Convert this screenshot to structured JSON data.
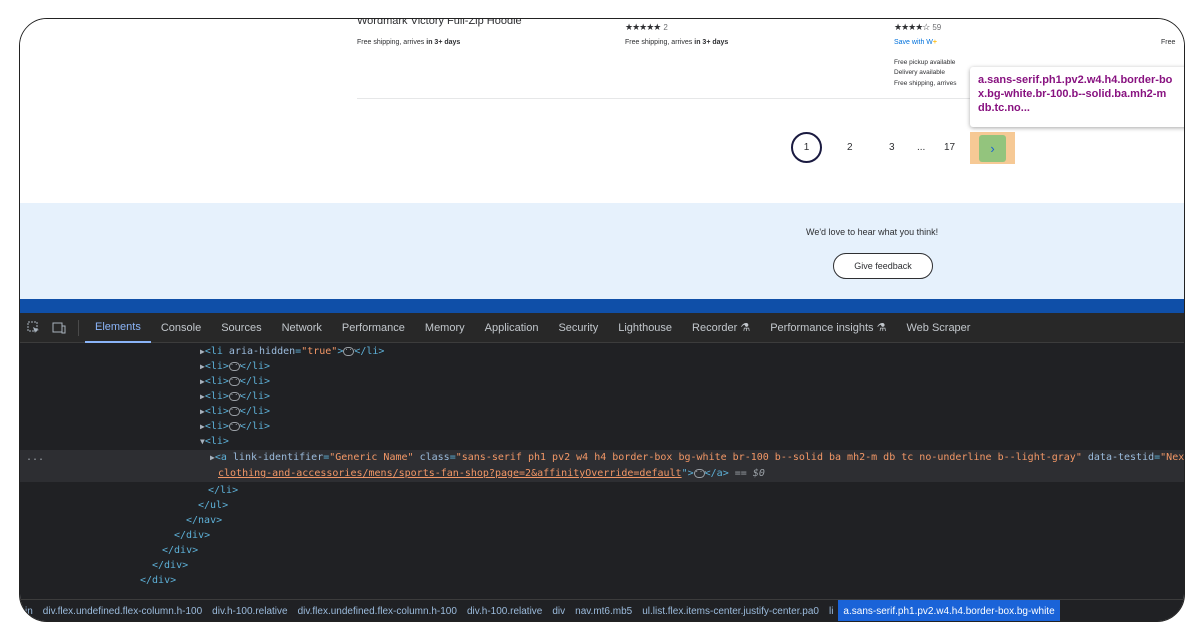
{
  "page": {
    "product_title": "Wordmark Victory Full-Zip Hoodie",
    "col1": {
      "shipping_prefix": "Free shipping, arrives ",
      "shipping_bold": "in 3+ days"
    },
    "col2": {
      "stars": "★★★★★",
      "count": "2",
      "shipping_prefix": "Free shipping, arrives ",
      "shipping_bold": "in 3+ days"
    },
    "col3": {
      "stars": "★★★★☆",
      "count": "59",
      "save_text": "Save with W+",
      "save_prefix": "Save with W",
      "save_plus": "+",
      "pickup": "Free pickup available",
      "delivery": "Delivery available",
      "shipping": "Free shipping, arrives"
    },
    "col4": {
      "shipping": "Free"
    },
    "tooltip": "a.sans-serif.ph1.pv2.w4.h4.border-box.bg-white.br-100.b--solid.ba.mh2-m db.tc.no...",
    "tooltip_lines": [
      "a.sans-serif.ph1.pv2.w4.h4.border-bo",
      "x.bg-white.br-100.b--solid.ba.mh2-m",
      "db.tc.no..."
    ],
    "pagination": {
      "current": "1",
      "p2": "2",
      "p3": "3",
      "ellipsis": "...",
      "last": "17",
      "next": "›"
    },
    "feedback": {
      "text": "We'd love to hear what you think!",
      "button": "Give feedback"
    }
  },
  "devtools": {
    "tabs": [
      "Elements",
      "Console",
      "Sources",
      "Network",
      "Performance",
      "Memory",
      "Application",
      "Security",
      "Lighthouse",
      "Recorder ⚗",
      "Performance insights ⚗",
      "Web Scraper"
    ],
    "active_tab": "Elements",
    "tree": {
      "li_hidden_tag": "<li",
      "li_hidden_attr": "aria-hidden",
      "li_hidden_val": "\"true\"",
      "li_tag": "<li>",
      "li_close": "</li>",
      "a_open": "<a",
      "a_attr1": "link-identifier",
      "a_val1": "\"Generic Name\"",
      "a_attr2": "class",
      "a_val2": "\"sans-serif ph1 pv2 w4 h4 border-box bg-white br-100 b--solid ba mh2-m db tc no-underline b--light-gray\"",
      "a_attr3": "data-testid",
      "a_val3": "\"NextPage\"",
      "a_href": "clothing-and-accessories/mens/sports-fan-shop?page=2&affinityOverride=default",
      "a_close": "</a>",
      "eq_sel": "== $0",
      "ul_close": "</ul>",
      "nav_close": "</nav>",
      "div_close": "</div>",
      "row_dots": "..."
    },
    "crumbs": [
      "in",
      "div.flex.undefined.flex-column.h-100",
      "div.h-100.relative",
      "div.flex.undefined.flex-column.h-100",
      "div.h-100.relative",
      "div",
      "nav.mt6.mb5",
      "ul.list.flex.items-center.justify-center.pa0",
      "li",
      "a.sans-serif.ph1.pv2.w4.h4.border-box.bg-white"
    ],
    "icons": [
      "inspect-icon",
      "device-toggle-icon"
    ]
  }
}
